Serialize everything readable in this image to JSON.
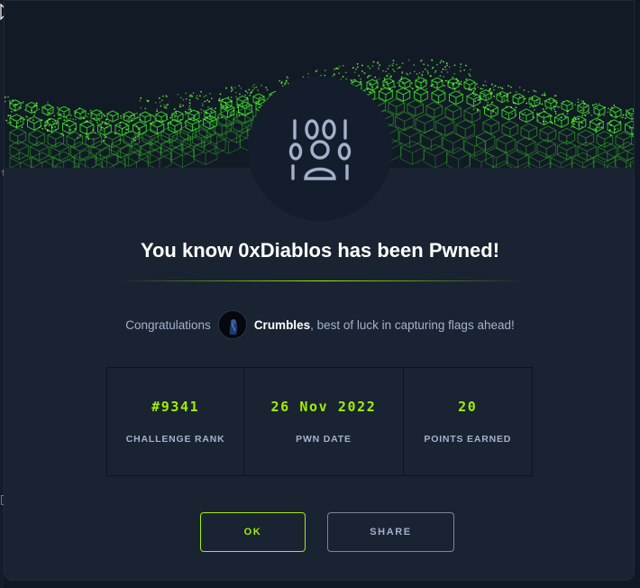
{
  "modal": {
    "title": "You know 0xDiablos has been Pwned!",
    "congrats": {
      "prefix": "Congratulations",
      "username": "Crumbles",
      "suffix": ", best of luck in capturing flags ahead!"
    },
    "stats": [
      {
        "value": "#9341",
        "label": "CHALLENGE RANK"
      },
      {
        "value": "26 Nov 2022",
        "label": "PWN DATE"
      },
      {
        "value": "20",
        "label": "POINTS EARNED"
      }
    ],
    "buttons": {
      "ok": "OK",
      "share": "SHARE"
    }
  },
  "icons": {
    "challenge": "binary-user-icon",
    "cursor": "mouse-cursor-icon"
  },
  "colors": {
    "accent": "#9fef00",
    "background": "#1a2332",
    "text_muted": "#a4b1cd"
  }
}
